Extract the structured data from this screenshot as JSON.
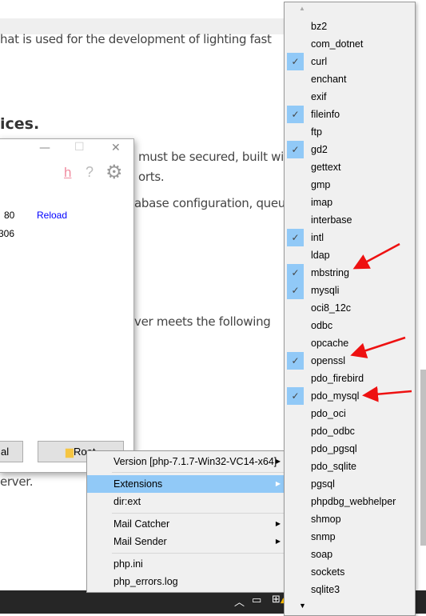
{
  "article": {
    "line1": "hat is used for the development of lighting fast",
    "heading": "ices.",
    "line2": "must be secured, built wit",
    "line3": "orts.",
    "line4": "abase configuration, queu",
    "line5": "ver meets the following",
    "line6": "erver."
  },
  "app_window": {
    "minimize": "—",
    "maximize": "☐",
    "close": "✕",
    "h_icon_label": "h",
    "help_label": "?",
    "row1_port": "80",
    "reload_link": "Reload",
    "row2_port": "306",
    "terminal_button": "al",
    "root_button": "Root"
  },
  "context_menu": {
    "items": [
      {
        "label": "Version [php-7.1.7-Win32-VC14-x64]",
        "submenu": true
      },
      {
        "label": "Extensions",
        "submenu": true,
        "highlighted": true
      },
      {
        "label": "dir:ext"
      },
      {
        "label": "Mail Catcher",
        "submenu": true
      },
      {
        "label": "Mail Sender",
        "submenu": true
      },
      {
        "label": "php.ini"
      },
      {
        "label": "php_errors.log"
      }
    ]
  },
  "extensions": {
    "items": [
      {
        "label": "bz2",
        "checked": false
      },
      {
        "label": "com_dotnet",
        "checked": false
      },
      {
        "label": "curl",
        "checked": true
      },
      {
        "label": "enchant",
        "checked": false
      },
      {
        "label": "exif",
        "checked": false
      },
      {
        "label": "fileinfo",
        "checked": true
      },
      {
        "label": "ftp",
        "checked": false
      },
      {
        "label": "gd2",
        "checked": true
      },
      {
        "label": "gettext",
        "checked": false
      },
      {
        "label": "gmp",
        "checked": false
      },
      {
        "label": "imap",
        "checked": false
      },
      {
        "label": "interbase",
        "checked": false
      },
      {
        "label": "intl",
        "checked": true
      },
      {
        "label": "ldap",
        "checked": false
      },
      {
        "label": "mbstring",
        "checked": true
      },
      {
        "label": "mysqli",
        "checked": true
      },
      {
        "label": "oci8_12c",
        "checked": false
      },
      {
        "label": "odbc",
        "checked": false
      },
      {
        "label": "opcache",
        "checked": false
      },
      {
        "label": "openssl",
        "checked": true
      },
      {
        "label": "pdo_firebird",
        "checked": false
      },
      {
        "label": "pdo_mysql",
        "checked": true
      },
      {
        "label": "pdo_oci",
        "checked": false
      },
      {
        "label": "pdo_odbc",
        "checked": false
      },
      {
        "label": "pdo_pgsql",
        "checked": false
      },
      {
        "label": "pdo_sqlite",
        "checked": false
      },
      {
        "label": "pgsql",
        "checked": false
      },
      {
        "label": "phpdbg_webhelper",
        "checked": false
      },
      {
        "label": "shmop",
        "checked": false
      },
      {
        "label": "snmp",
        "checked": false
      },
      {
        "label": "soap",
        "checked": false
      },
      {
        "label": "sockets",
        "checked": false
      },
      {
        "label": "sqlite3",
        "checked": false
      }
    ]
  },
  "colors": {
    "highlight": "#91c9f7",
    "annotation_arrow": "#ee1111",
    "link": "#0000ff",
    "h_icon": "#f08ca0"
  }
}
